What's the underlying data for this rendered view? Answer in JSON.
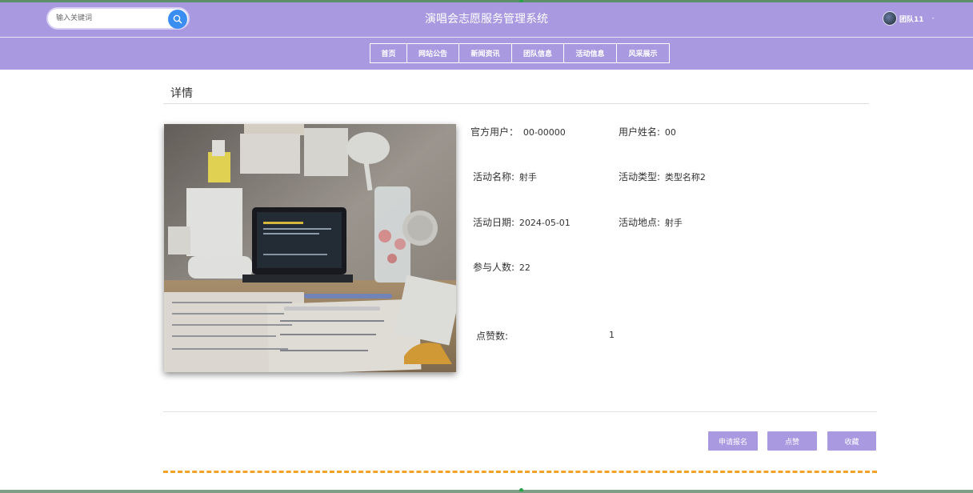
{
  "header": {
    "title": "演唱会志愿服务管理系统",
    "search_placeholder": "输入关键词",
    "username": "团队11",
    "user_menu_arrow": "-"
  },
  "nav": {
    "items": [
      {
        "label": "首页"
      },
      {
        "label": "网站公告"
      },
      {
        "label": "新闻资讯"
      },
      {
        "label": "团队信息"
      },
      {
        "label": "活动信息"
      },
      {
        "label": "风采展示"
      }
    ]
  },
  "detail": {
    "section_title": "详情",
    "fields": {
      "official_user": {
        "label": "官方用户：",
        "value": "00-00000"
      },
      "user_name": {
        "label": "用户姓名:",
        "value": "00"
      },
      "activity_name": {
        "label": "活动名称:",
        "value": "射手"
      },
      "activity_type": {
        "label": "活动类型:",
        "value": "类型名称2"
      },
      "activity_date": {
        "label": "活动日期:",
        "value": "2024-05-01"
      },
      "activity_location": {
        "label": "活动地点:",
        "value": "射手"
      },
      "participants": {
        "label": "参与人数:",
        "value": "22"
      },
      "likes": {
        "label": "点赞数:",
        "value": "1"
      }
    }
  },
  "actions": {
    "apply_label": "申请报名",
    "like_label": "点赞",
    "favorite_label": "收藏"
  },
  "colors": {
    "header_bg": "#a899e1",
    "search_button": "#3a8ef2",
    "dashed_divider": "#f5a22a"
  },
  "icons": {
    "search": "search-icon",
    "avatar": "avatar-image"
  }
}
